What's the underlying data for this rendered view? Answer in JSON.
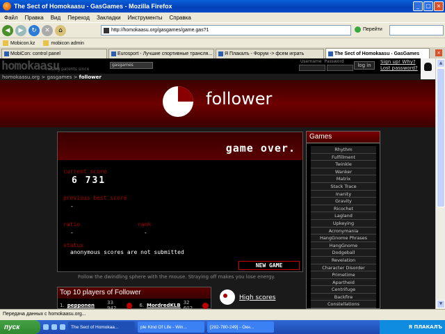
{
  "window": {
    "title": "The Sect of Homokaasu - GasGames - Mozilla Firefox"
  },
  "menu": [
    "Файл",
    "Правка",
    "Вид",
    "Переход",
    "Закладки",
    "Инструменты",
    "Справка"
  ],
  "toolbar": {
    "url": "http://homokaasu.org/gasgames/game.gas?1",
    "go_label": "Перейти"
  },
  "bookmarks": [
    "Mobicon.kz",
    "mobicon admin"
  ],
  "tabs": [
    {
      "label": "MobiCon: control panel"
    },
    {
      "label": "Eurosport - Лучшие спортивные трансля..."
    },
    {
      "label": "Я Плакалъ - Форум -> фсем играть"
    },
    {
      "label": "The Sect of Homokaasu - GasGames",
      "active": true
    }
  ],
  "site": {
    "logo": "homokaasu",
    "tagline": "raising parents since",
    "section_select": "gasgames",
    "username_label": "Username",
    "password_label": "Password",
    "login_label": "log in",
    "signup_label": "Sign up! Why?",
    "lost_password_label": "Lost password?",
    "breadcrumb": {
      "home": "homokaasu.org",
      "sep": " > ",
      "section": "gasgames",
      "current": "follower"
    }
  },
  "game": {
    "title": "follower",
    "game_over": "game over.",
    "current_score_label": "current score",
    "current_score": "6 731",
    "previous_best_label": "previous best score",
    "previous_best": "-",
    "ratio_label": "ratio",
    "ratio": "-",
    "rank_label": "rank",
    "rank": "-",
    "status_label": "status",
    "status": "anonymous scores are not submitted",
    "new_game_label": "NEW GAME",
    "hint": "Follow the dwindling sphere with the mouse. Straying off makes you lose energy."
  },
  "top10": {
    "title": "Top 10 players of Follower",
    "rows": [
      {
        "rank": "1.",
        "name": "pepponen",
        "score": "33 942"
      },
      {
        "rank": "6.",
        "name": "MordredKLB",
        "score": "32 602"
      }
    ]
  },
  "high_scores_label": "High scores",
  "games_sidebar": {
    "title": "Games",
    "items": [
      "Rhythm",
      "Fulfillment",
      "Twinkle",
      "Wanker",
      "Matrix",
      "Stack Trace",
      "Inanity",
      "Gravity",
      "Ricochet",
      "Lagland",
      "Upkeying",
      "Acronymania",
      "HangGnome Phrases",
      "HangGnome",
      "Dodgeball",
      "Revelation",
      "Character Disorder",
      "Primetime",
      "Apartheid",
      "Centrifuge",
      "Backfire",
      "Constellations"
    ]
  },
  "status_bar": "Передача данных с homokaasu.org...",
  "taskbar": {
    "start": "пуск",
    "tasks": [
      {
        "label": "The Sect of Homokaa...",
        "active": true
      },
      {
        "label": "ple Kind Of Life - Win..."
      },
      {
        "label": "[282-780-249] - Окн..."
      }
    ],
    "tray": "Я ПЛАКАЛЪ"
  },
  "colors": {
    "accent": "#6e0000",
    "label_red": "#aa0000",
    "xp_blue": "#1c48b0"
  }
}
